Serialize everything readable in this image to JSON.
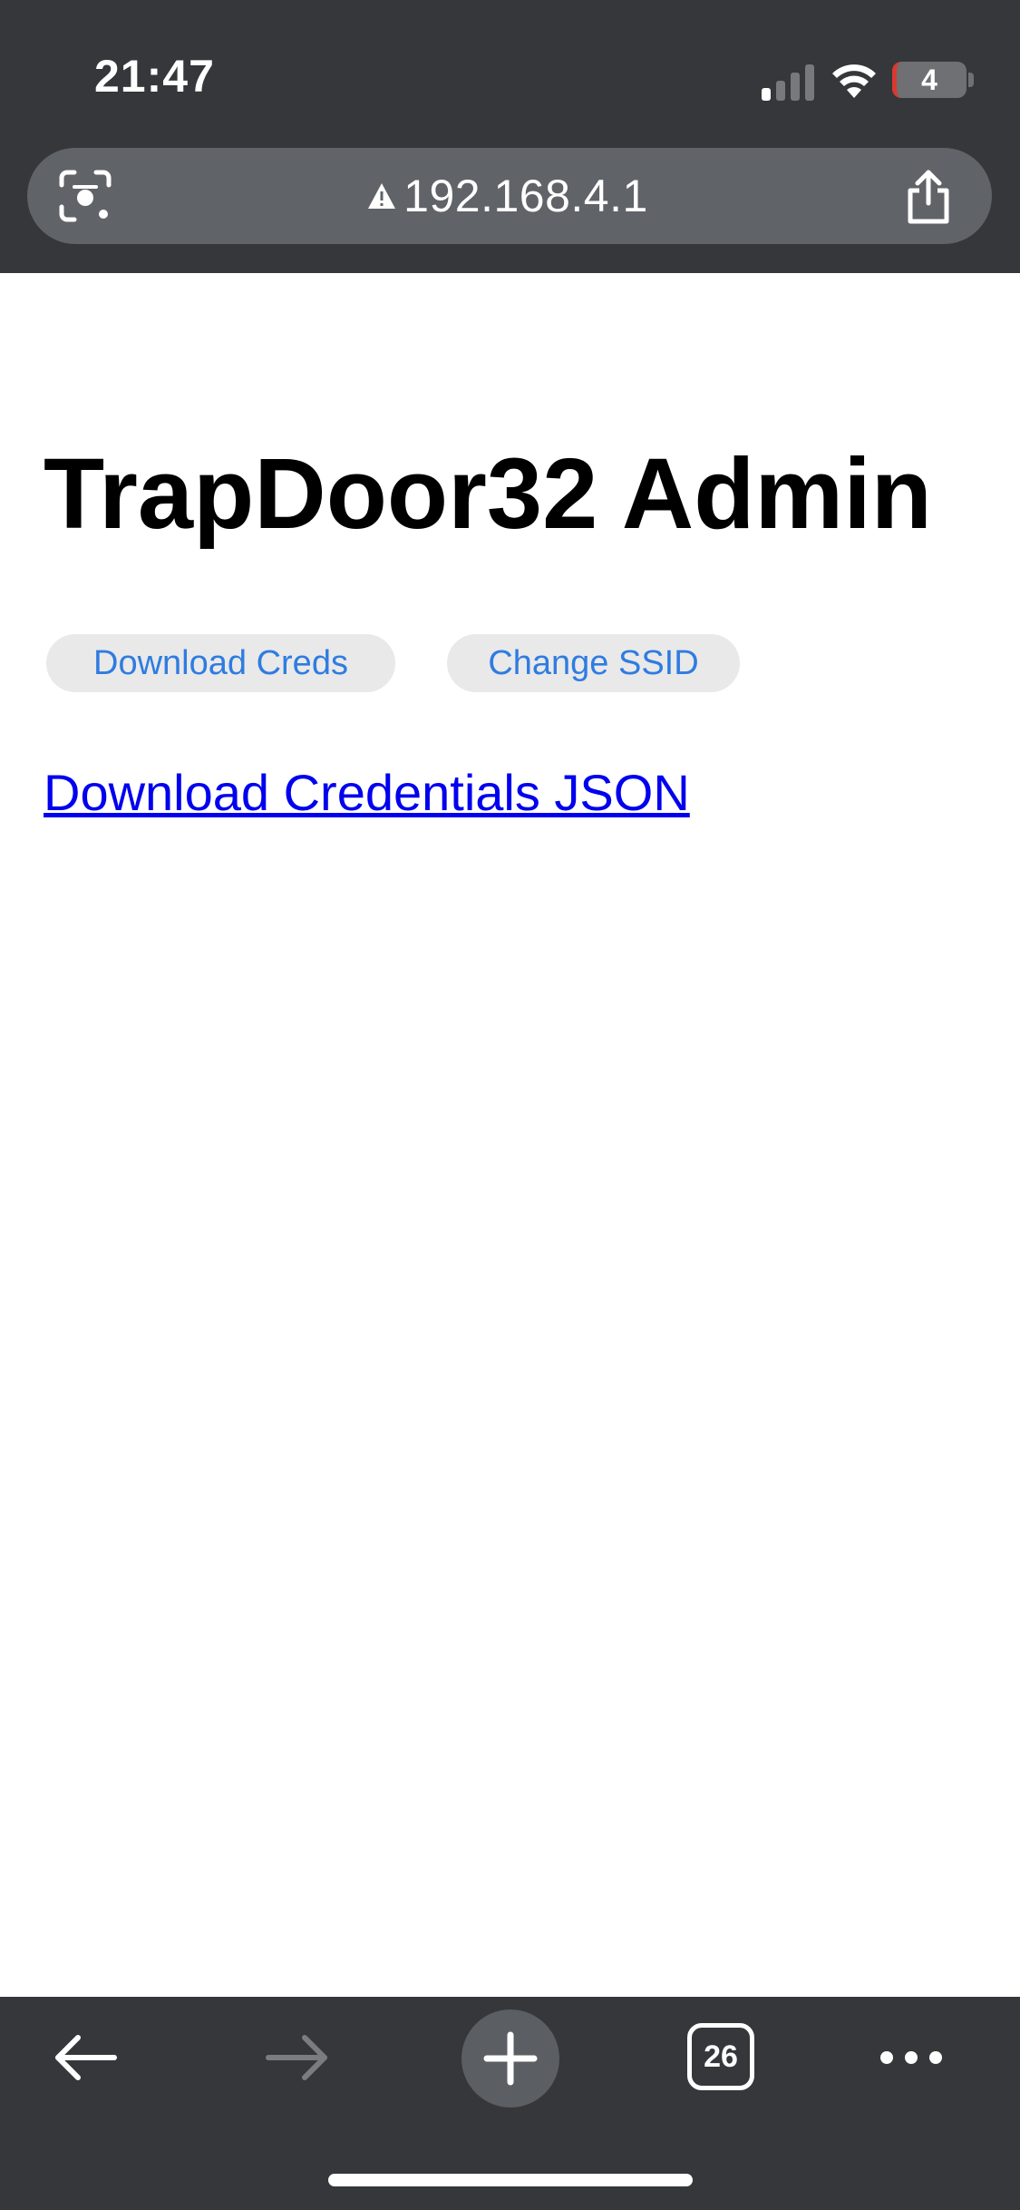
{
  "status_bar": {
    "time": "21:47",
    "battery_level": "4",
    "icons": [
      "signal-icon",
      "wifi-icon",
      "battery-icon"
    ]
  },
  "browser": {
    "url": "192.168.4.1",
    "security_icon": "warning-triangle-icon",
    "toolbar_icons": [
      "back-arrow-icon",
      "forward-arrow-icon",
      "plus-icon",
      "tabs-icon",
      "more-dots-icon"
    ],
    "tab_count": "26"
  },
  "page": {
    "title": "TrapDoor32 Admin",
    "buttons": {
      "download_creds": "Download Creds",
      "change_ssid": "Change SSID"
    },
    "link": "Download Credentials JSON"
  },
  "colors": {
    "chrome": "#35373a",
    "url_bar": "#606367",
    "button_bg": "#e9e9ea",
    "button_text": "#2f7ce0",
    "link": "#0000ee"
  }
}
